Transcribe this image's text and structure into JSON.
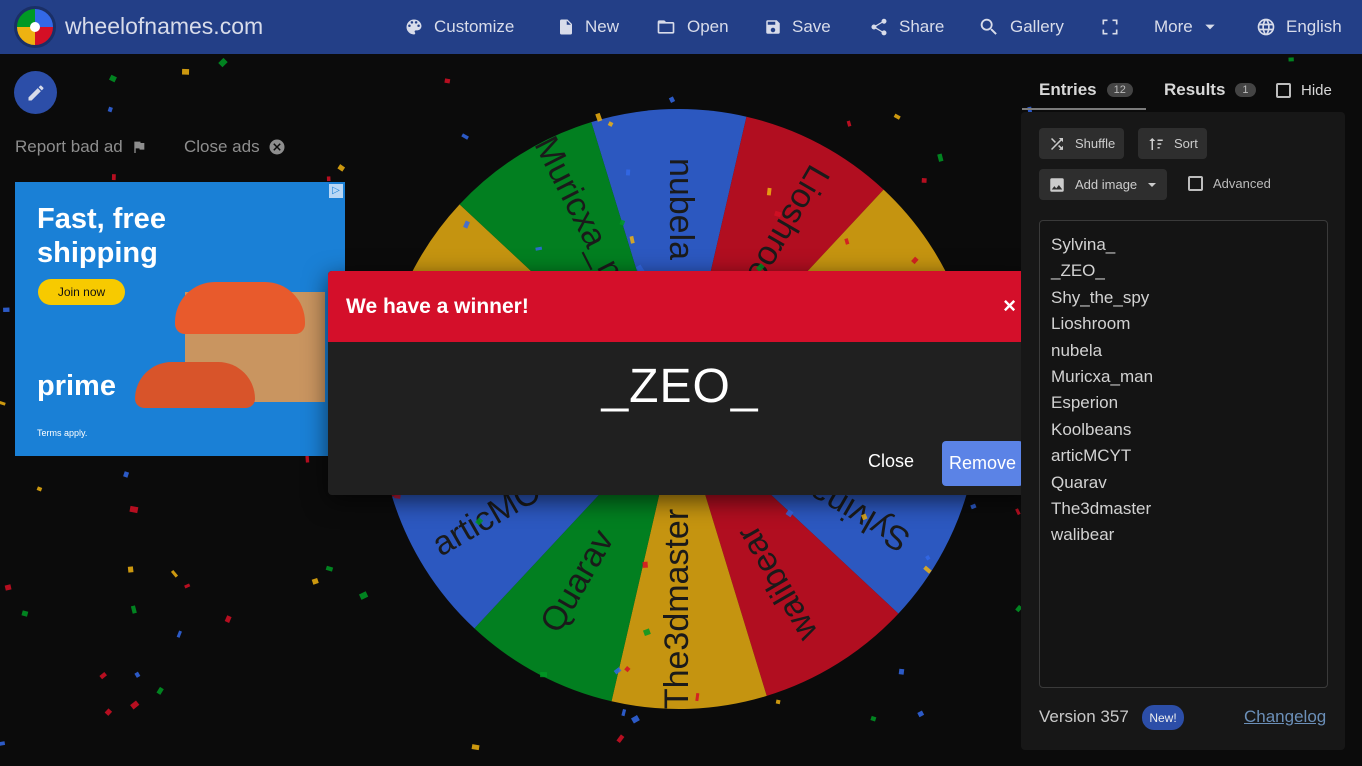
{
  "topbar": {
    "site_title": "wheelofnames.com",
    "nav": [
      {
        "label": "Customize",
        "icon": "palette-icon"
      },
      {
        "label": "New",
        "icon": "file-icon"
      },
      {
        "label": "Open",
        "icon": "folder-open-icon"
      },
      {
        "label": "Save",
        "icon": "save-icon"
      },
      {
        "label": "Share",
        "icon": "share-icon"
      },
      {
        "label": "Gallery",
        "icon": "search-icon"
      },
      {
        "label": "",
        "icon": "fullscreen-icon"
      },
      {
        "label": "More",
        "icon": "chevron-down-icon"
      },
      {
        "label": "English",
        "icon": "globe-icon"
      }
    ]
  },
  "left": {
    "report_ad": "Report bad ad",
    "close_ads": "Close ads",
    "ad": {
      "headline": "Fast, free shipping",
      "cta": "Join now",
      "brand": "prime",
      "terms": "Terms apply."
    }
  },
  "wheel": {
    "colors": [
      "#3369e8",
      "#d50f25",
      "#eeb211",
      "#009925"
    ],
    "visible_labels": [
      "nubela",
      "Muricxa_man",
      "Lioshroom",
      "articMCYT",
      "Quarav",
      "The3dmaster",
      "walibear",
      "Sylvina_"
    ]
  },
  "dialog": {
    "title": "We have a winner!",
    "close_x": "×",
    "winner": "_ZEO_",
    "close_label": "Close",
    "remove_label": "Remove"
  },
  "panel": {
    "tab_entries": "Entries",
    "entries_count": "12",
    "tab_results": "Results",
    "results_count": "1",
    "hide_label": "Hide",
    "shuffle_label": "Shuffle",
    "sort_label": "Sort",
    "add_image_label": "Add image",
    "advanced_label": "Advanced",
    "entries": [
      "Sylvina_",
      "_ZEO_",
      "Shy_the_spy",
      "Lioshroom",
      "nubela",
      "Muricxa_man",
      "Esperion",
      "Koolbeans",
      "articMCYT",
      "Quarav",
      "The3dmaster",
      "walibear"
    ],
    "version": "Version 357",
    "new_badge": "New!",
    "changelog": "Changelog"
  },
  "colors": {
    "topbar": "#233f87",
    "dialog_header": "#d40f2a",
    "remove_button": "#5b83e6"
  }
}
